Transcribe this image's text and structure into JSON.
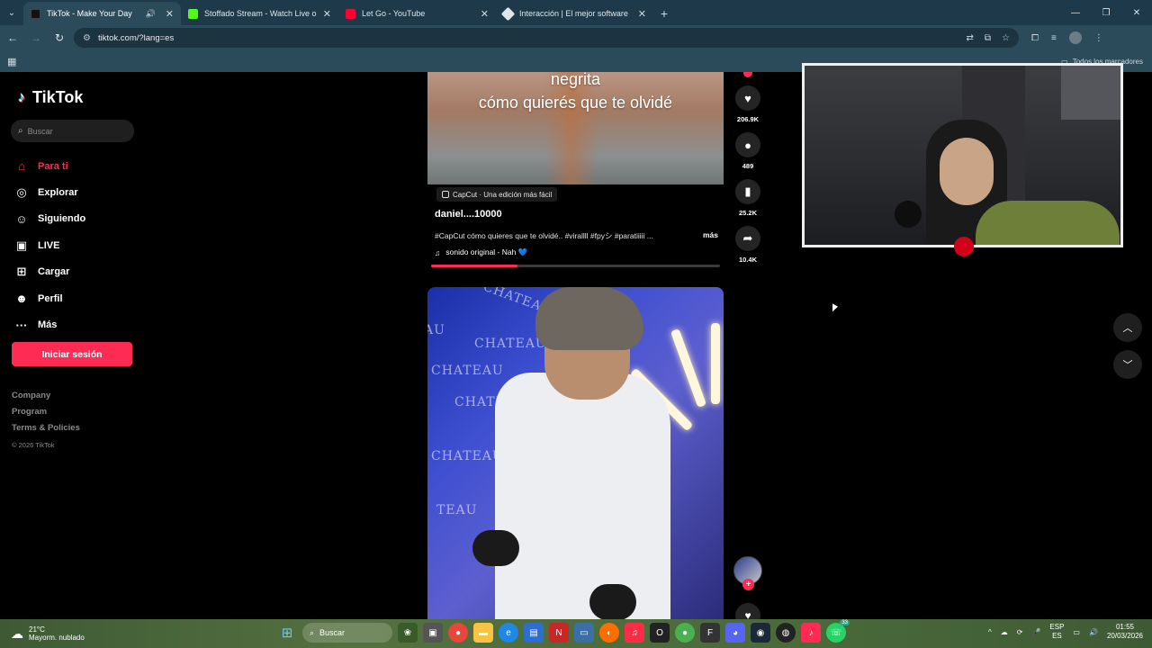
{
  "browser": {
    "tabs": [
      {
        "title": "TikTok - Make Your Day",
        "favicon_color": "#111111",
        "active": true,
        "audio": true
      },
      {
        "title": "Stoffado Stream - Watch Live o",
        "favicon_color": "#53fc18",
        "active": false,
        "audio": false
      },
      {
        "title": "Let Go - YouTube",
        "favicon_color": "#ff0033",
        "active": false,
        "audio": false
      },
      {
        "title": "Interacción | El mejor software",
        "favicon_color": "#dfe6ea",
        "active": false,
        "audio": false
      }
    ],
    "url": "tiktok.com/?lang=es",
    "all_bookmarks": "Todos los marcadores"
  },
  "tiktok": {
    "logo": "TikTok",
    "search_placeholder": "Buscar",
    "nav": [
      {
        "label": "Para ti",
        "icon": "home-icon",
        "active": true
      },
      {
        "label": "Explorar",
        "icon": "compass-icon",
        "active": false
      },
      {
        "label": "Siguiendo",
        "icon": "following-icon",
        "active": false
      },
      {
        "label": "LIVE",
        "icon": "live-icon",
        "active": false
      },
      {
        "label": "Cargar",
        "icon": "upload-icon",
        "active": false
      },
      {
        "label": "Perfil",
        "icon": "profile-icon",
        "active": false
      },
      {
        "label": "Más",
        "icon": "more-icon",
        "active": false
      }
    ],
    "login_label": "Iniciar sesión",
    "footer": {
      "links": [
        "Company",
        "Program",
        "Terms & Policies"
      ],
      "copyright": "© 2026 TikTok"
    },
    "accent": "#fe2c55",
    "video1": {
      "caption_line1": "negrita",
      "caption_line2": "cómo quierés que te olvidé",
      "capcut_badge": "CapCut · Una edición más fácil",
      "author": "daniel....10000",
      "description": "#CapCut cómo quieres que te olvidé.. #virallll #fpyシ #paratiiiii ...",
      "more": "más",
      "sound": "sonido original - Nah 💙",
      "progress": 0.3,
      "likes": "206.9K",
      "comments": "489",
      "saves": "25.2K",
      "shares": "10.4K"
    },
    "video2": {
      "brand_text": "CHATEAU"
    }
  },
  "taskbar": {
    "temperature": "21°C",
    "weather": "Mayorm. nublado",
    "search": "Buscar",
    "lang_top": "ESP",
    "lang_bottom": "ES",
    "time": "01:55",
    "date": "20/03/2026",
    "badge": "33"
  }
}
